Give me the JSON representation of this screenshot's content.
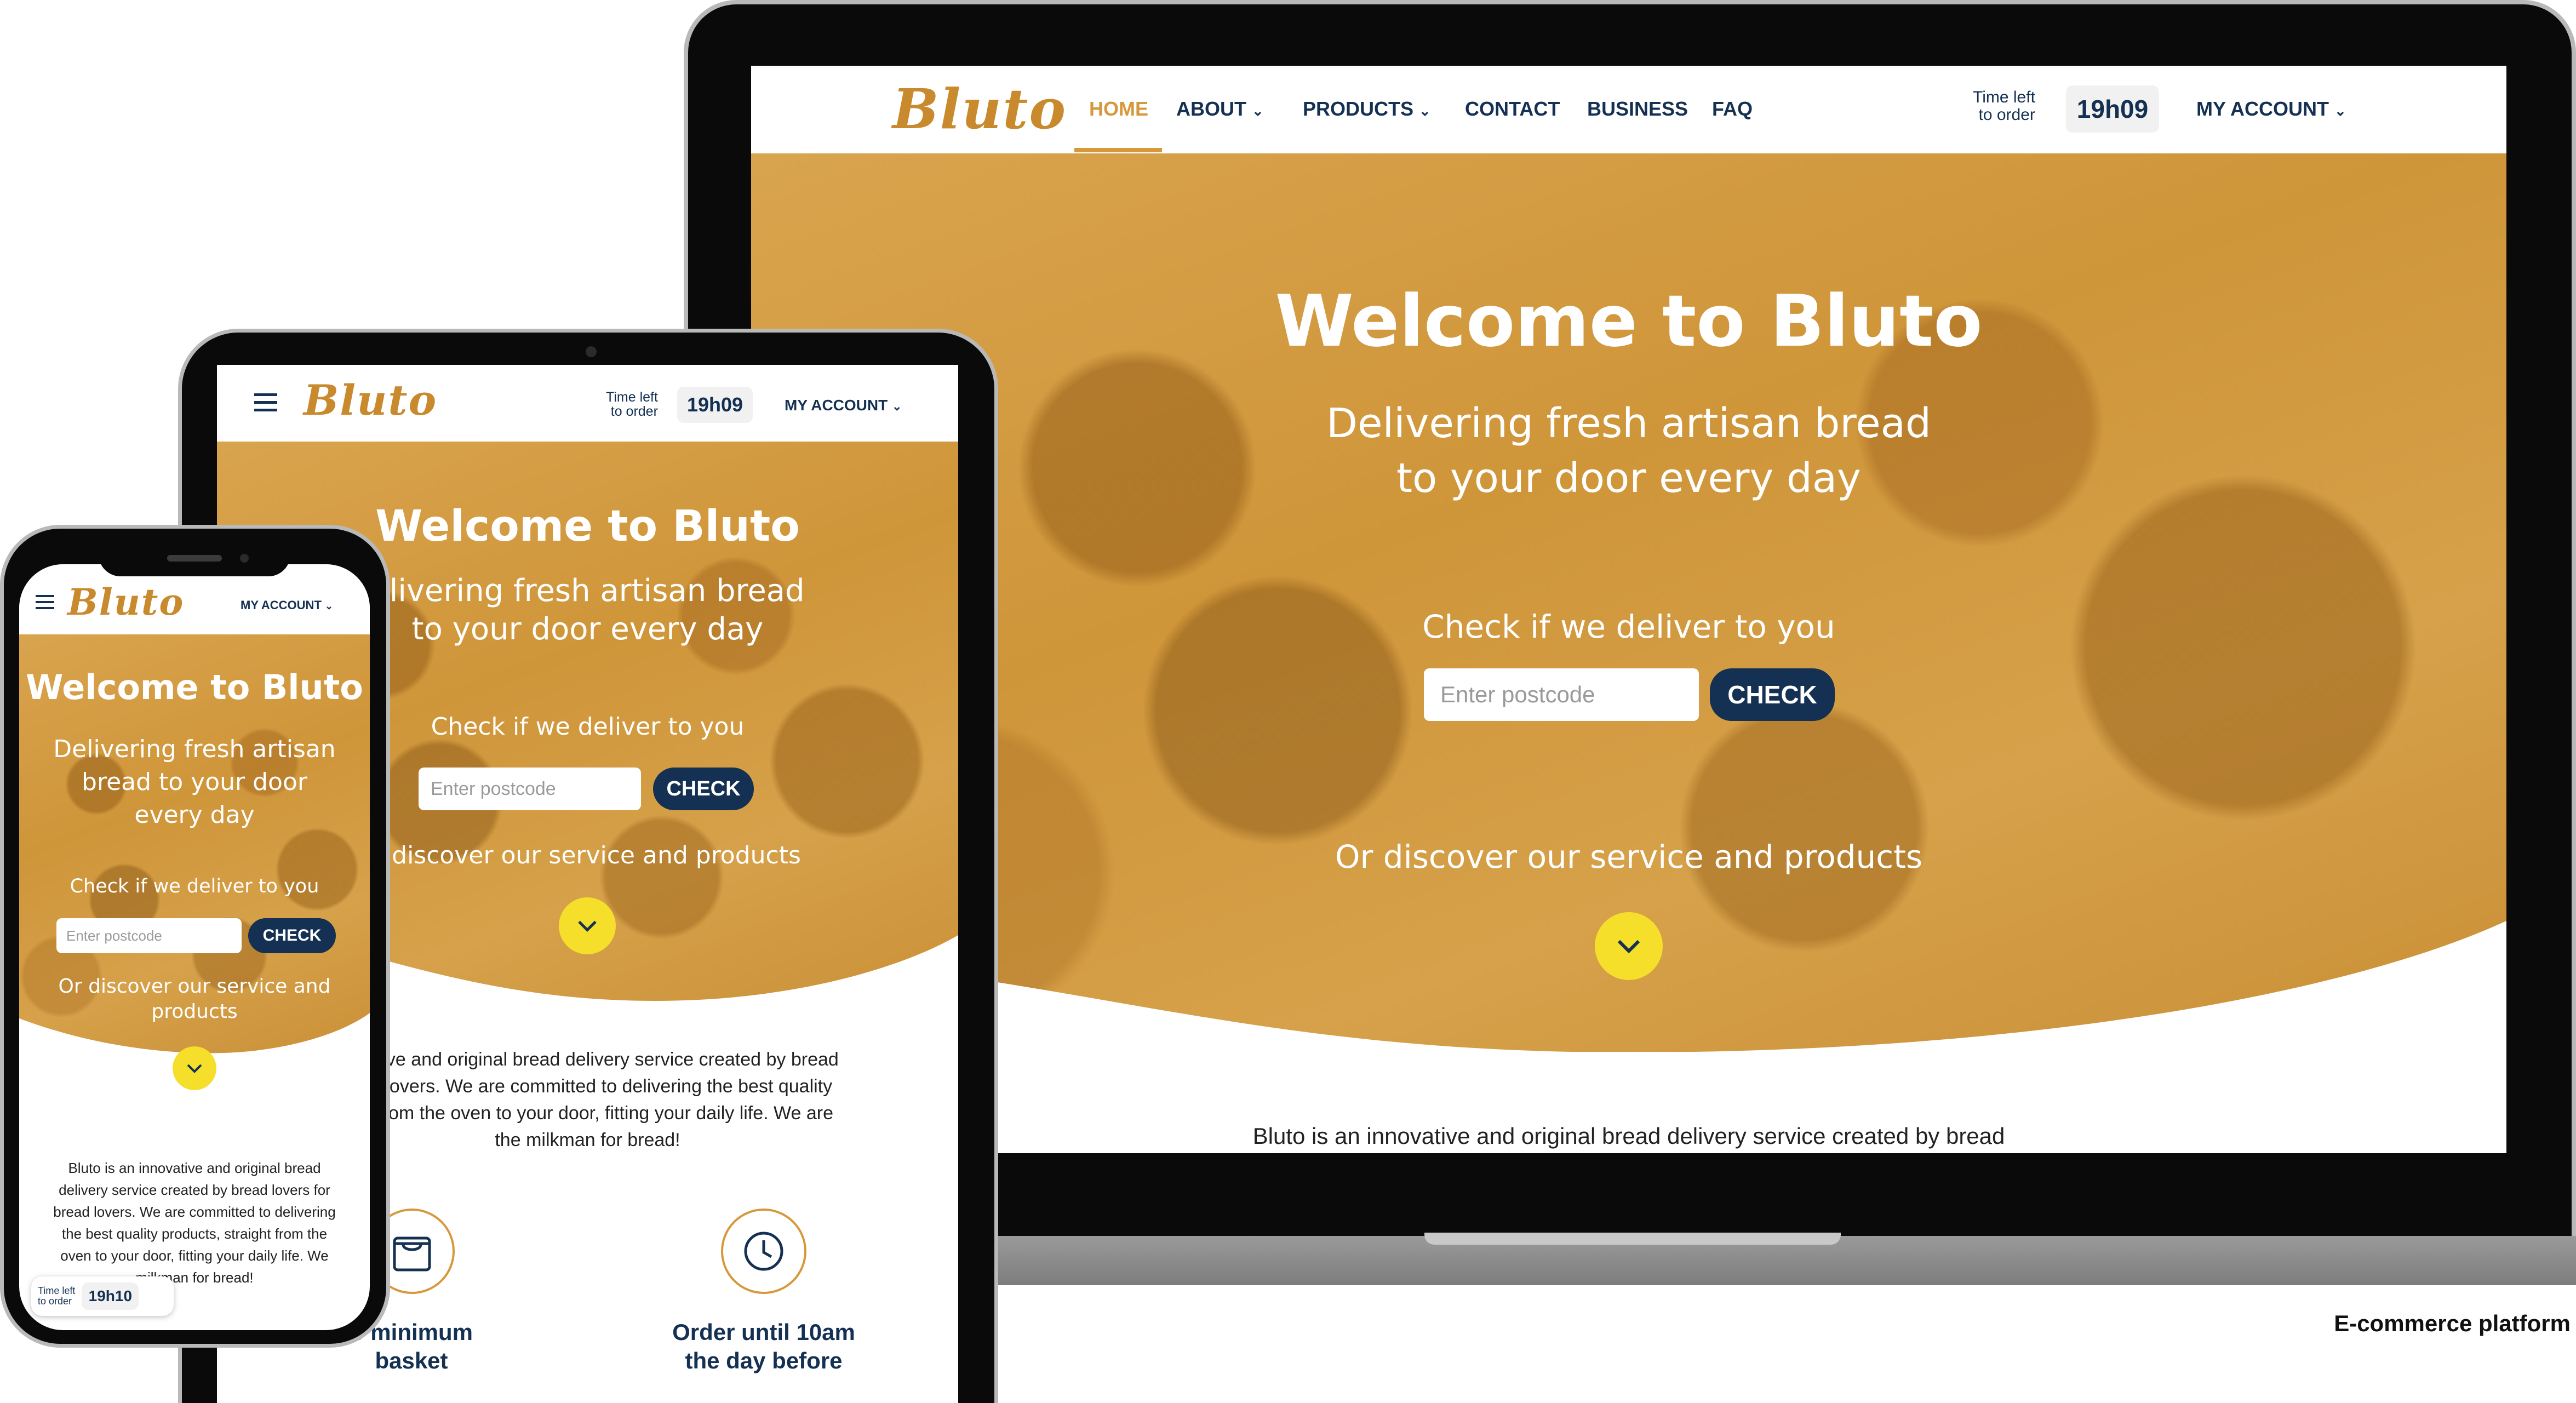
{
  "brand": {
    "name": "Bluto",
    "accent": "#d6983a",
    "navy": "#143052",
    "yellow": "#f6df2b"
  },
  "nav": {
    "items": [
      {
        "label": "HOME",
        "active": true
      },
      {
        "label": "ABOUT",
        "dropdown": true
      },
      {
        "label": "PRODUCTS",
        "dropdown": true
      },
      {
        "label": "CONTACT"
      },
      {
        "label": "BUSINESS"
      },
      {
        "label": "FAQ"
      }
    ],
    "time_left_line1": "Time left",
    "time_left_line2": "to order",
    "time_value": "19h09",
    "phone_time_value": "19h10",
    "account": "MY ACCOUNT"
  },
  "hero": {
    "title": "Welcome to Bluto",
    "subtitle_line1": "Delivering fresh artisan bread",
    "subtitle_line2": "to your door every day",
    "tablet_sub1": "elivering fresh artisan bread",
    "tablet_sub2": "to your door every day",
    "phone_sub1": "Delivering fresh artisan",
    "phone_sub2": "bread to your door",
    "phone_sub3": "every day",
    "check_label": "Check if we deliver to you",
    "postcode_placeholder": "Enter postcode",
    "check_button": "CHECK",
    "discover": "Or discover our service and products",
    "tablet_discover": "r discover our service and products",
    "phone_discover1": "Or discover our service and",
    "phone_discover2": "products"
  },
  "intro": {
    "laptop_line": "Bluto is an innovative and original bread delivery service created by bread",
    "tablet_lines": [
      "novative and original bread delivery service created by bread",
      "read lovers. We are committed to delivering the best quality",
      "ight from the oven to your door, fitting your daily life. We are",
      "the milkman for bread!"
    ],
    "phone_lines": [
      "Bluto is an innovative and original bread",
      "delivery service created by bread lovers for",
      "bread lovers. We are committed to delivering",
      "the best quality products, straight from the",
      "oven to your door, fitting your daily life. We",
      "milkman for bread!"
    ]
  },
  "features": [
    {
      "icon": "shopping-bag-icon",
      "line1": "o minimum",
      "line2": "basket"
    },
    {
      "icon": "clock-icon",
      "line1": "Order until 10am",
      "line2": "the day before"
    }
  ],
  "caption": "E-commerce platform"
}
